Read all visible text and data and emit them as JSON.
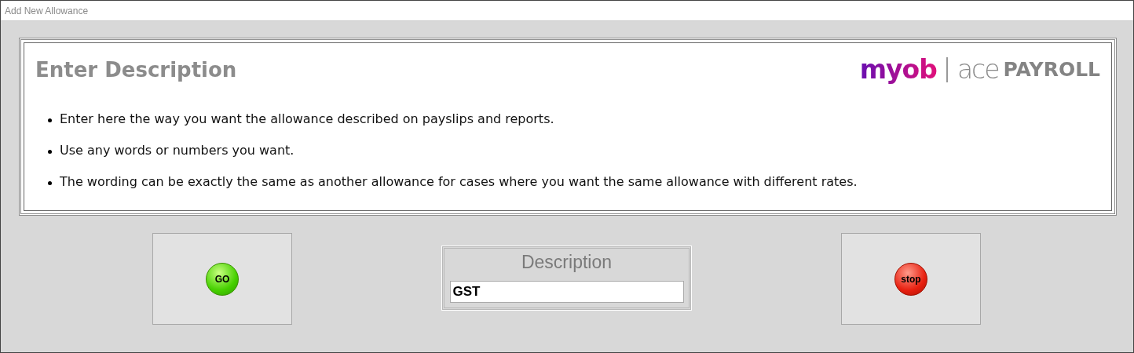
{
  "window": {
    "title": "Add New Allowance"
  },
  "panel": {
    "heading": "Enter Description",
    "logo": {
      "brand": "myob",
      "product_prefix": "ace",
      "product": "PAYROLL"
    },
    "bullets": [
      "Enter here the way you want the allowance described on payslips and reports.",
      "Use any words or numbers you want.",
      "The wording can be exactly the same as another allowance for cases where you want the same allowance with different rates."
    ]
  },
  "go_button": {
    "label": "GO"
  },
  "description_field": {
    "label": "Description",
    "value": "GST"
  },
  "stop_button": {
    "label": "stop"
  }
}
